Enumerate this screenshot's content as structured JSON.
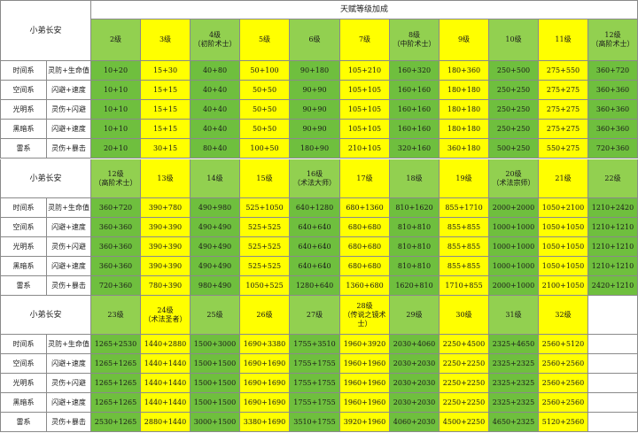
{
  "title": "天赋等级加成",
  "sections": [
    {
      "name": "小弟长安",
      "levels": [
        "2级",
        "3级",
        "4级\n（初阶术士）",
        "5级",
        "6级",
        "7级",
        "8级\n（中阶术士）",
        "9级",
        "10级",
        "11级",
        "12级\n（高阶术士）"
      ],
      "rows": [
        {
          "sys": "时间系",
          "attr": "灵防+生命值",
          "vals": [
            "10+20",
            "15+30",
            "40+80",
            "50+100",
            "90+180",
            "105+210",
            "160+320",
            "180+360",
            "250+500",
            "275+550",
            "360+720"
          ]
        },
        {
          "sys": "空间系",
          "attr": "闪避+速度",
          "vals": [
            "10+10",
            "15+15",
            "40+40",
            "50+50",
            "90+90",
            "105+105",
            "160+160",
            "180+180",
            "250+250",
            "275+275",
            "360+360"
          ]
        },
        {
          "sys": "光明系",
          "attr": "灵伤+闪避",
          "vals": [
            "10+10",
            "15+15",
            "40+40",
            "50+50",
            "90+90",
            "105+105",
            "160+160",
            "180+180",
            "250+250",
            "275+275",
            "360+360"
          ]
        },
        {
          "sys": "黑暗系",
          "attr": "闪避+速度",
          "vals": [
            "10+10",
            "15+15",
            "40+40",
            "50+50",
            "90+90",
            "105+105",
            "160+160",
            "180+180",
            "250+250",
            "275+275",
            "360+360"
          ]
        },
        {
          "sys": "雷系",
          "attr": "灵伤+暴击",
          "vals": [
            "20+10",
            "30+15",
            "80+40",
            "100+50",
            "180+90",
            "210+105",
            "320+160",
            "360+180",
            "500+250",
            "550+275",
            "720+360"
          ]
        }
      ]
    },
    {
      "name": "小弟长安",
      "levels": [
        "12级\n（高阶术士）",
        "13级",
        "14级",
        "15级",
        "16级\n（术法大师）",
        "17级",
        "18级",
        "19级",
        "20级\n（术法宗师）",
        "21级",
        "22级"
      ],
      "rows": [
        {
          "sys": "时间系",
          "attr": "灵防+生命值",
          "vals": [
            "360+720",
            "390+780",
            "490+980",
            "525+1050",
            "640+1280",
            "680+1360",
            "810+1620",
            "855+1710",
            "2000+2000",
            "1050+2100",
            "1210+2420"
          ]
        },
        {
          "sys": "空间系",
          "attr": "闪避+速度",
          "vals": [
            "360+360",
            "390+390",
            "490+490",
            "525+525",
            "640+640",
            "680+680",
            "810+810",
            "855+855",
            "1000+1000",
            "1050+1050",
            "1210+1210"
          ]
        },
        {
          "sys": "光明系",
          "attr": "灵伤+闪避",
          "vals": [
            "360+360",
            "390+390",
            "490+490",
            "525+525",
            "640+640",
            "680+680",
            "810+810",
            "855+855",
            "1000+1000",
            "1050+1050",
            "1210+1210"
          ]
        },
        {
          "sys": "黑暗系",
          "attr": "闪避+速度",
          "vals": [
            "360+360",
            "390+390",
            "490+490",
            "525+525",
            "640+640",
            "680+680",
            "810+810",
            "855+855",
            "1000+1000",
            "1050+1050",
            "1210+1210"
          ]
        },
        {
          "sys": "雷系",
          "attr": "灵伤+暴击",
          "vals": [
            "720+360",
            "780+390",
            "980+490",
            "1050+525",
            "1280+640",
            "1360+680",
            "1620+810",
            "1710+855",
            "2000+1000",
            "2100+1050",
            "2420+1210"
          ]
        }
      ]
    },
    {
      "name": "小弟长安",
      "levels": [
        "23级",
        "24级\n（术法圣者）",
        "25级",
        "26级",
        "27级",
        "28级\n（传说之镜术士）",
        "29级",
        "30级",
        "31级",
        "32级"
      ],
      "rows": [
        {
          "sys": "时间系",
          "attr": "灵防+生命值",
          "vals": [
            "1265+2530",
            "1440+2880",
            "1500+3000",
            "1690+3380",
            "1755+3510",
            "1960+3920",
            "2030+4060",
            "2250+4500",
            "2325+4650",
            "2560+5120"
          ]
        },
        {
          "sys": "空间系",
          "attr": "闪避+速度",
          "vals": [
            "1265+1265",
            "1440+1440",
            "1500+1500",
            "1690+1690",
            "1755+1755",
            "1960+1960",
            "2030+2030",
            "2250+2250",
            "2325+2325",
            "2560+2560"
          ]
        },
        {
          "sys": "光明系",
          "attr": "灵伤+闪避",
          "vals": [
            "1265+1265",
            "1440+1440",
            "1500+1500",
            "1690+1690",
            "1755+1755",
            "1960+1960",
            "2030+2030",
            "2250+2250",
            "2325+2325",
            "2560+2560"
          ]
        },
        {
          "sys": "黑暗系",
          "attr": "闪避+速度",
          "vals": [
            "1265+1265",
            "1440+1440",
            "1500+1500",
            "1690+1690",
            "1755+1755",
            "1960+1960",
            "2030+2030",
            "2250+2250",
            "2325+2325",
            "2560+2560"
          ]
        },
        {
          "sys": "雷系",
          "attr": "灵伤+暴击",
          "vals": [
            "2530+1265",
            "2880+1440",
            "3000+1500",
            "3380+1690",
            "3510+1755",
            "3920+1960",
            "4060+2030",
            "4500+2250",
            "4650+2325",
            "5120+2560"
          ]
        }
      ]
    }
  ],
  "colors": {
    "header_green": "#92d050",
    "header_yellow": "#ffff00",
    "body_dark_green": "#6fbf3e",
    "body_yellow": "#ffff00",
    "grid_line": "#8a8a8a"
  }
}
